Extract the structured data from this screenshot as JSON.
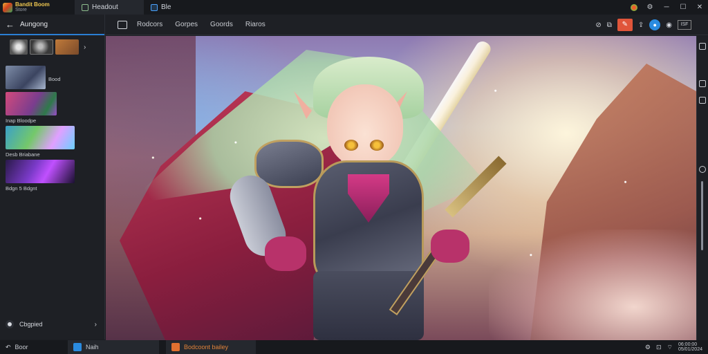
{
  "titlebar": {
    "brand_line1": "Bandit Boom",
    "brand_line2": "Store",
    "tabs": [
      {
        "label": "Headout",
        "icon": "image-icon"
      },
      {
        "label": "Ble",
        "icon": "browser-icon"
      }
    ],
    "window_controls": [
      "gear-icon",
      "minimize-icon",
      "maximize-icon",
      "close-icon"
    ]
  },
  "sidebar": {
    "header_label": "Aungong",
    "cards": [
      {
        "caption": "Bood"
      },
      {
        "caption": "Inap Bloodpe"
      },
      {
        "caption": "Desb Briabane"
      },
      {
        "caption": "Bdgn 5 Bdgnt"
      }
    ],
    "footer_label": "Cbgpied"
  },
  "toolbar": {
    "menu": [
      "Rodcors",
      "Gorpes",
      "Goords",
      "Riaros"
    ],
    "box_label": "ISF"
  },
  "taskbar": {
    "back_label": "Boor",
    "main_label": "Naih",
    "project_label": "Bodcoont bailey",
    "clock_line1": "06:00:00",
    "clock_line2": "05/01/2024"
  },
  "colors": {
    "accent": "#2a7fd4",
    "danger": "#e0553a",
    "background": "#1b1d22"
  }
}
